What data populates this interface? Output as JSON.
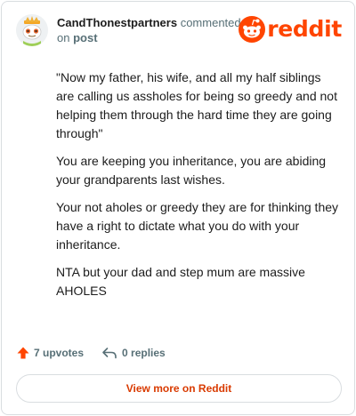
{
  "header": {
    "username": "CandThonestpartners",
    "action_text": "commented",
    "on_text": "on",
    "post_link": "post",
    "logo_wordmark": "reddit"
  },
  "comment": {
    "paragraphs": [
      "\"Now my father, his wife, and all my half siblings are calling us assholes for being so greedy and not helping them through the hard time they are going through\"",
      "You are keeping you inheritance, you are abiding your grandparents last wishes.",
      "Your not aholes or greedy they are for thinking they have a right to dictate what you do with your inheritance.",
      "NTA but your dad and step mum are massive AHOLES"
    ]
  },
  "actions": {
    "upvotes_label": "7 upvotes",
    "replies_label": "0 replies",
    "upvote_icon": "upvote-arrow-icon",
    "reply_icon": "reply-arrow-icon"
  },
  "cta": {
    "view_more_label": "View more on Reddit"
  },
  "colors": {
    "brand": "#ff4500",
    "cta_text": "#d93a00",
    "muted": "#576f76",
    "border": "#d9dde0"
  }
}
